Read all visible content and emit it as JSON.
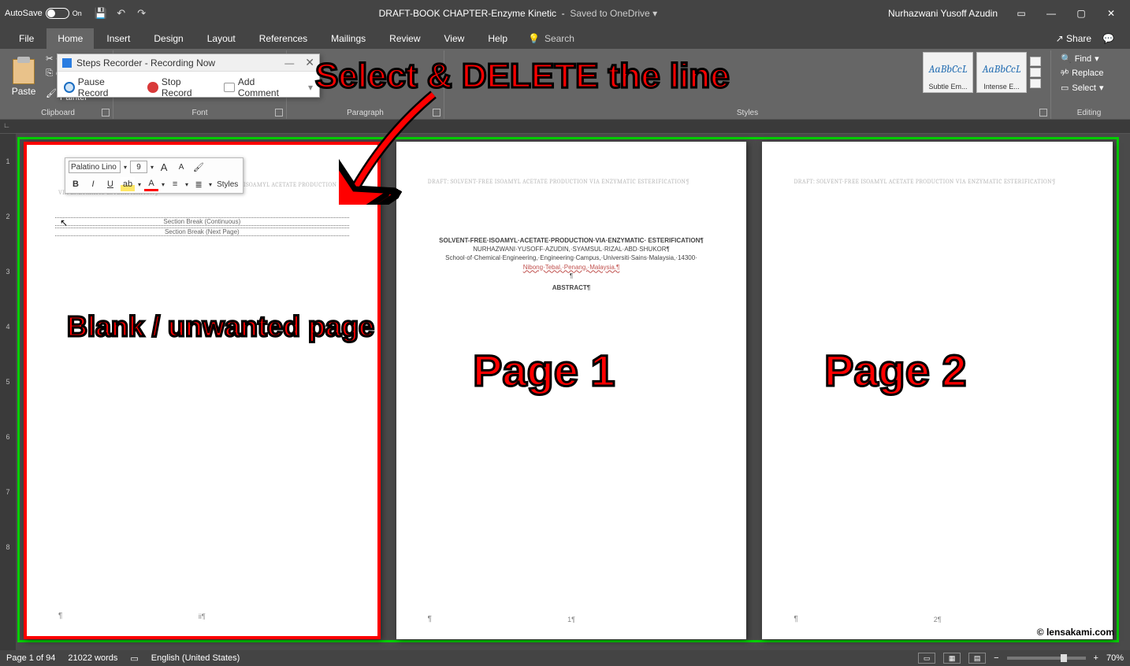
{
  "titlebar": {
    "autosave_label": "AutoSave",
    "autosave_state": "On",
    "doc_name": "DRAFT-BOOK CHAPTER-Enzyme Kinetic",
    "saved_text": "Saved to OneDrive ▾",
    "user": "Nurhazwani Yusoff Azudin"
  },
  "tabs": [
    "File",
    "Home",
    "Insert",
    "Design",
    "Layout",
    "References",
    "Mailings",
    "Review",
    "View",
    "Help"
  ],
  "search_placeholder": "Search",
  "share_label": "Share",
  "ribbon": {
    "clipboard": {
      "paste": "Paste",
      "cut": "Cut",
      "copy": "Copy",
      "format_painter": "Format Painter",
      "label": "Clipboard"
    },
    "font_label": "Font",
    "paragraph_label": "Paragraph",
    "styles_label": "Styles",
    "editing_label": "Editing",
    "styles": [
      {
        "preview": "AaBbCcL",
        "name": "Subtle Em..."
      },
      {
        "preview": "AaBbCcL",
        "name": "Intense E..."
      }
    ],
    "editing": {
      "find": "Find",
      "replace": "Replace",
      "select": "Select"
    }
  },
  "recorder": {
    "title": "Steps Recorder - Recording Now",
    "pause": "Pause Record",
    "stop": "Stop Record",
    "comment": "Add Comment"
  },
  "minitoolbar": {
    "font": "Palatino Lino",
    "size": "9",
    "styles_btn": "Styles"
  },
  "section_breaks": {
    "continuous": "Section Break (Continuous)",
    "next_page": "Section Break (Next Page)"
  },
  "page_header": "DRAFT: SOLVENT-FREE ISOAMYL ACETATE PRODUCTION VIA ENZYMATIC ESTERIFICATION¶",
  "page1_body": {
    "title": "SOLVENT-FREE·ISOAMYL·ACETATE·PRODUCTION·VIA·ENZYMATIC· ESTERIFICATION¶",
    "authors": "NURHAZWANI·YUSOFF·AZUDIN,·SYAMSUL·RIZAL·ABD·SHUKOR¶",
    "affil": "School·of·Chemical·Engineering,·Engineering·Campus,·Universiti·Sains·Malaysia,·14300·",
    "affil2": "Nibong·Tebal,·Penang,·Malaysia.¶",
    "abstract": "ABSTRACT¶"
  },
  "page_numbers": {
    "blank": "ii¶",
    "p1": "1¶",
    "p2": "2¶"
  },
  "annotations": {
    "instruction": "Select & DELETE the line",
    "blank": "Blank / unwanted page",
    "page1": "Page 1",
    "page2": "Page 2",
    "watermark": "© lensakami.com"
  },
  "status": {
    "page": "Page 1 of 94",
    "words": "21022 words",
    "lang": "English (United States)",
    "zoom": "70%"
  },
  "vruler_marks": [
    "1",
    "2",
    "3",
    "4",
    "5",
    "6",
    "7",
    "8"
  ]
}
